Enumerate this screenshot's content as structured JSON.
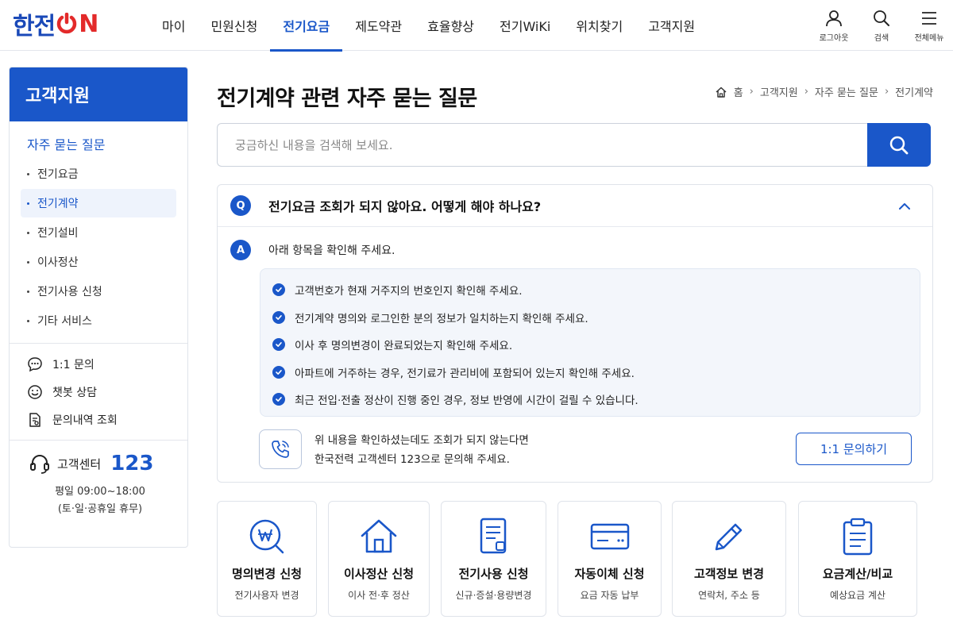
{
  "header": {
    "logo": {
      "part1": "한전",
      "part2": "ON"
    },
    "nav": [
      "마이",
      "민원신청",
      "전기요금",
      "제도약관",
      "효율향상",
      "전기WiKi",
      "위치찾기",
      "고객지원"
    ],
    "nav_active_index": 2,
    "util": {
      "logout": "로그아웃",
      "search": "검색",
      "menu": "전체메뉴"
    }
  },
  "sidebar": {
    "title": "고객지원",
    "subtitle": "자주 묻는 질문",
    "items": [
      "전기요금",
      "전기계약",
      "전기설비",
      "이사정산",
      "전기사용 신청",
      "기타 서비스"
    ],
    "active_index": 1,
    "menu": {
      "inquiry": "1:1 문의",
      "chatbot": "챗봇 상담",
      "history": "문의내역 조회"
    },
    "center": {
      "label": "고객센터",
      "number": "123",
      "hours1": "평일 09:00~18:00",
      "hours2": "(토·일·공휴일 휴무)"
    }
  },
  "main": {
    "title": "전기계약 관련 자주 묻는 질문",
    "breadcrumb": {
      "home": "홈",
      "level1": "고객지원",
      "level2": "자주 묻는 질문",
      "level3": "전기계약"
    },
    "search": {
      "placeholder": "궁금하신 내용을 검색해 보세요."
    },
    "faq": {
      "q_badge": "Q",
      "question": "전기요금 조회가 되지 않아요. 어떻게 해야 하나요?",
      "a_badge": "A",
      "answer_intro": "아래 항목을 확인해 주세요.",
      "checks": [
        "고객번호가 현재 거주지의 번호인지 확인해 주세요.",
        "전기계약 명의와 로그인한 분의 정보가 일치하는지 확인해 주세요.",
        "이사 후 명의변경이 완료되었는지 확인해 주세요.",
        "아파트에 거주하는 경우, 전기료가 관리비에 포함되어 있는지 확인해 주세요.",
        "최근 전입·전출 정산이 진행 중인 경우, 정보 반영에 시간이 걸릴 수 있습니다."
      ],
      "help_line1": "위 내용을 확인하셨는데도 조회가 되지 않는다면",
      "help_line2": "한국전력 고객센터 123으로 문의해 주세요.",
      "inquiry_button": "1:1 문의하기"
    },
    "cards": [
      {
        "title": "명의변경 신청",
        "sub": "전기사용자 변경",
        "icon": "won-coin-icon"
      },
      {
        "title": "이사정산 신청",
        "sub": "이사 전·후 정산",
        "icon": "house-icon"
      },
      {
        "title": "전기사용 신청",
        "sub": "신규·증설·용량변경",
        "icon": "document-icon"
      },
      {
        "title": "자동이체 신청",
        "sub": "요금 자동 납부",
        "icon": "credit-card-icon"
      },
      {
        "title": "고객정보 변경",
        "sub": "연락처, 주소 등",
        "icon": "pencil-icon"
      },
      {
        "title": "요금계산/비교",
        "sub": "예상요금 계산",
        "icon": "clipboard-icon"
      }
    ]
  },
  "colors": {
    "primary": "#1a57c9",
    "logo_red": "#e32a2a"
  }
}
